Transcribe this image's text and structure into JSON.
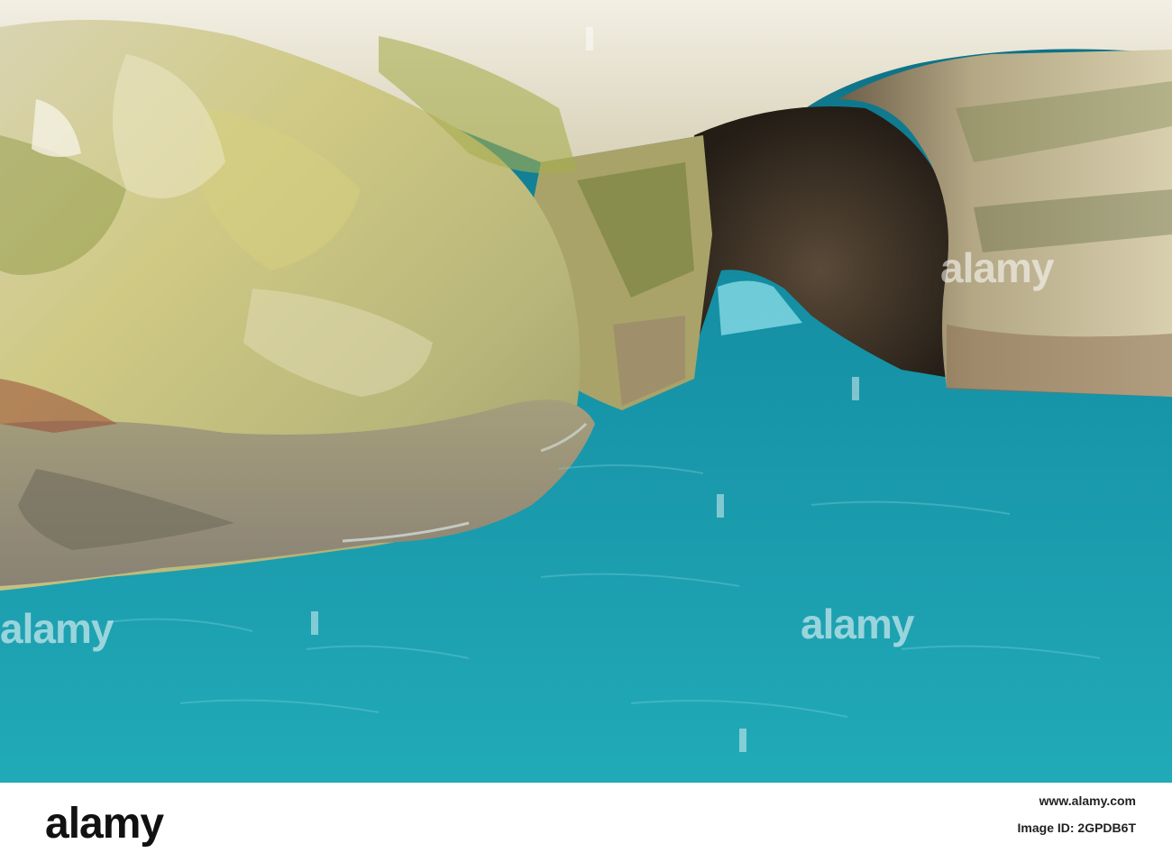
{
  "photo": {
    "subject": "",
    "colors": {
      "water": "#1aa0b0",
      "water_deep": "#0b6f82",
      "rock_light": "#e8e2c8",
      "rock_yellow": "#c8c47a",
      "rock_moss": "#7e8a3c",
      "tunnel_dark": "#2a241e"
    }
  },
  "watermark": {
    "text": "alamy"
  },
  "footer": {
    "logo": "alamy",
    "image_id": "Image ID: 2GPDB6T",
    "url": "www.alamy.com"
  }
}
